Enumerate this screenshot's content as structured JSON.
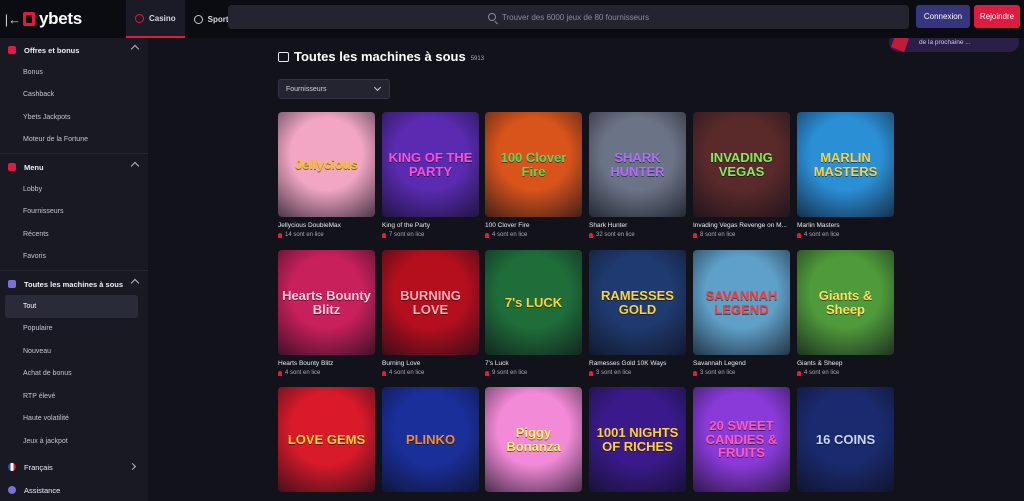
{
  "header": {
    "collapse_icon": "arrow-left-bar-icon",
    "logo_text": "ybets",
    "tabs": [
      {
        "label": "Casino",
        "icon": "cherry-icon",
        "active": true
      },
      {
        "label": "Sport",
        "icon": "ball-icon",
        "active": false
      }
    ],
    "search_placeholder": "Trouver des 6000 jeux de 80 fournisseurs",
    "login_label": "Connexion",
    "join_label": "Rejoindre"
  },
  "sidebar": {
    "sections": [
      {
        "title": "Offres et bonus",
        "items": [
          "Bonus",
          "Cashback",
          "Ybets Jackpots",
          "Moteur de la Fortune"
        ]
      },
      {
        "title": "Menu",
        "items": [
          "Lobby",
          "Fournisseurs",
          "Récents",
          "Favoris"
        ]
      },
      {
        "title": "Toutes les machines à sous",
        "items": [
          "Tout",
          "Populaire",
          "Nouveau",
          "Achat de bonus",
          "RTP élevé",
          "Haute volatilité",
          "Jeux à jackpot"
        ]
      }
    ],
    "active_item": "Tout",
    "language": "Français",
    "assistance": "Assistance"
  },
  "main": {
    "promo_text": "de la prochaine ...",
    "title": "Toutes les machines à sous",
    "count": "5913",
    "filter_label": "Fournisseurs",
    "games": [
      {
        "name": "Jellycious DoubleMax",
        "players": "14 sont en lice",
        "art": "Jellycious",
        "bg": "#f2a6c4",
        "fg": "#f7c21a"
      },
      {
        "name": "King of the Party",
        "players": "7 sont en lice",
        "art": "KING OF THE PARTY",
        "bg": "#5a2bb0",
        "fg": "#ff4fd8"
      },
      {
        "name": "100 Clover Fire",
        "players": "4 sont en lice",
        "art": "100 Clover Fire",
        "bg": "#d8541a",
        "fg": "#4fe05a"
      },
      {
        "name": "Shark Hunter",
        "players": "32 sont en lice",
        "art": "SHARK HUNTER",
        "bg": "#6b7486",
        "fg": "#b36bff"
      },
      {
        "name": "Invading Vegas Revenge on M...",
        "players": "8 sont en lice",
        "art": "INVADING VEGAS",
        "bg": "#5a2a2a",
        "fg": "#7cf05a"
      },
      {
        "name": "Marlin Masters",
        "players": "4 sont en lice",
        "art": "MARLIN MASTERS",
        "bg": "#2b8fd6",
        "fg": "#ffd23a"
      },
      {
        "name": "Hearts Bounty Blitz",
        "players": "4 sont en lice",
        "art": "Hearts Bounty Blitz",
        "bg": "#c8205a",
        "fg": "#ffd0e4"
      },
      {
        "name": "Burning Love",
        "players": "4 sont en lice",
        "art": "BURNING LOVE",
        "bg": "#b50f1e",
        "fg": "#ffb0b8"
      },
      {
        "name": "7's Luck",
        "players": "9 sont en lice",
        "art": "7's LUCK",
        "bg": "#1f6e3a",
        "fg": "#ffd23a"
      },
      {
        "name": "Ramesses Gold 10K Ways",
        "players": "3 sont en lice",
        "art": "RAMESSES GOLD",
        "bg": "#1f3a6e",
        "fg": "#ffd23a"
      },
      {
        "name": "Savannah Legend",
        "players": "3 sont en lice",
        "art": "SAVANNAH LEGEND",
        "bg": "#5fa0c8",
        "fg": "#ff3a3a"
      },
      {
        "name": "Giants & Sheep",
        "players": "4 sont en lice",
        "art": "Giants & Sheep",
        "bg": "#4f9a3a",
        "fg": "#ffe05a"
      },
      {
        "name": "",
        "players": "",
        "art": "LOVE GEMS",
        "bg": "#d81a2a",
        "fg": "#ffd23a"
      },
      {
        "name": "",
        "players": "",
        "art": "PLINKO",
        "bg": "#1a2f9a",
        "fg": "#ff8a1a"
      },
      {
        "name": "",
        "players": "",
        "art": "Piggy Bonanza",
        "bg": "#f28ad8",
        "fg": "#fff06a"
      },
      {
        "name": "",
        "players": "",
        "art": "1001 NIGHTS OF RICHES",
        "bg": "#3a1a8a",
        "fg": "#ffd23a"
      },
      {
        "name": "",
        "players": "",
        "art": "20 SWEET CANDIES & FRUITS",
        "bg": "#8a3ad8",
        "fg": "#ff5ab8"
      },
      {
        "name": "",
        "players": "",
        "art": "16 COINS",
        "bg": "#1a2a6e",
        "fg": "#c8d8ff"
      }
    ]
  }
}
